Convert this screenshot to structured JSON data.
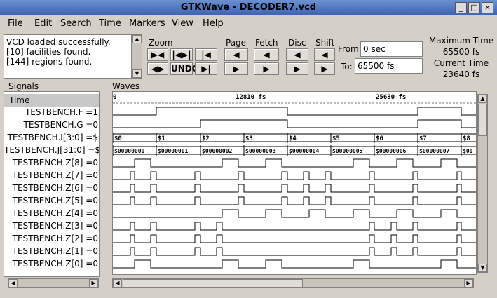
{
  "window": {
    "title": "GTKWave - DECODER7.vcd"
  },
  "menu": [
    "File",
    "Edit",
    "Search",
    "Time",
    "Markers",
    "View",
    "Help"
  ],
  "messages": [
    "VCD loaded successfully.",
    "[10] facilities found.",
    "[144] regions found."
  ],
  "toolbar": {
    "zoom_label": "Zoom",
    "undo_label": "UNDO",
    "page_label": "Page",
    "fetch_label": "Fetch",
    "disc_label": "Disc",
    "shift_label": "Shift",
    "from_label": "From:",
    "from_value": "0 sec",
    "to_label": "To:",
    "to_value": "65500 fs"
  },
  "times": {
    "max_label": "Maximum Time",
    "max_value": "65500 fs",
    "cur_label": "Current Time",
    "cur_value": "23640 fs"
  },
  "signals_pane": {
    "title": "Signals",
    "header": "Time",
    "rows": [
      "TESTBENCH.F =1",
      "TESTBENCH.G =0",
      "TESTBENCH.I[3:0] =$",
      "TESTBENCH.J[31:0] =$",
      "TESTBENCH.Z[8] =0",
      "TESTBENCH.Z[7] =0",
      "TESTBENCH.Z[6] =0",
      "TESTBENCH.Z[5] =0",
      "TESTBENCH.Z[4] =0",
      "TESTBENCH.Z[3] =0",
      "TESTBENCH.Z[2] =0",
      "TESTBENCH.Z[1] =0",
      "TESTBENCH.Z[0] =0"
    ]
  },
  "waves_pane": {
    "title": "Waves",
    "time_markers": [
      "0",
      "12810 fs",
      "25630 fs"
    ],
    "bus_i": [
      "$0",
      "$1",
      "$2",
      "$3",
      "$4",
      "$5",
      "$6",
      "$7",
      "$8"
    ],
    "bus_j": [
      "$00000000",
      "$00000001",
      "$00000002",
      "$00000003",
      "$00000004",
      "$00000005",
      "$00000006",
      "$00000007",
      "$00"
    ]
  }
}
